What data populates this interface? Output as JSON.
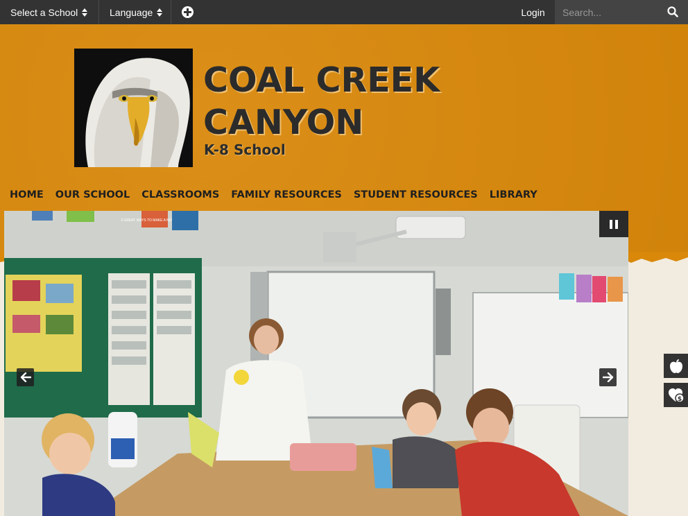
{
  "topbar": {
    "school_select": "Select a School",
    "language_select": "Language",
    "login": "Login",
    "search_placeholder": "Search..."
  },
  "header": {
    "title_line1": "COAL CREEK",
    "title_line2": "CANYON",
    "subtitle": "K-8 School"
  },
  "nav": {
    "items": [
      "HOME",
      "OUR SCHOOL",
      "CLASSROOMS",
      "FAMILY RESOURCES",
      "STUDENT RESOURCES",
      "LIBRARY"
    ]
  },
  "hero": {
    "classroom_poster": "3 GREAT WAYS TO MAKE A NEW FRIEND"
  },
  "side_badge": "$",
  "colors": {
    "header_bg": "#d9880a",
    "topbar_bg": "#333333",
    "title_text": "#2b2b2b",
    "page_bg": "#f2ece0"
  },
  "icons": [
    "sort-icon",
    "plus-circle-icon",
    "search-icon",
    "pause-icon",
    "arrow-left-icon",
    "arrow-right-icon",
    "apple-icon",
    "heart-dollar-icon"
  ]
}
